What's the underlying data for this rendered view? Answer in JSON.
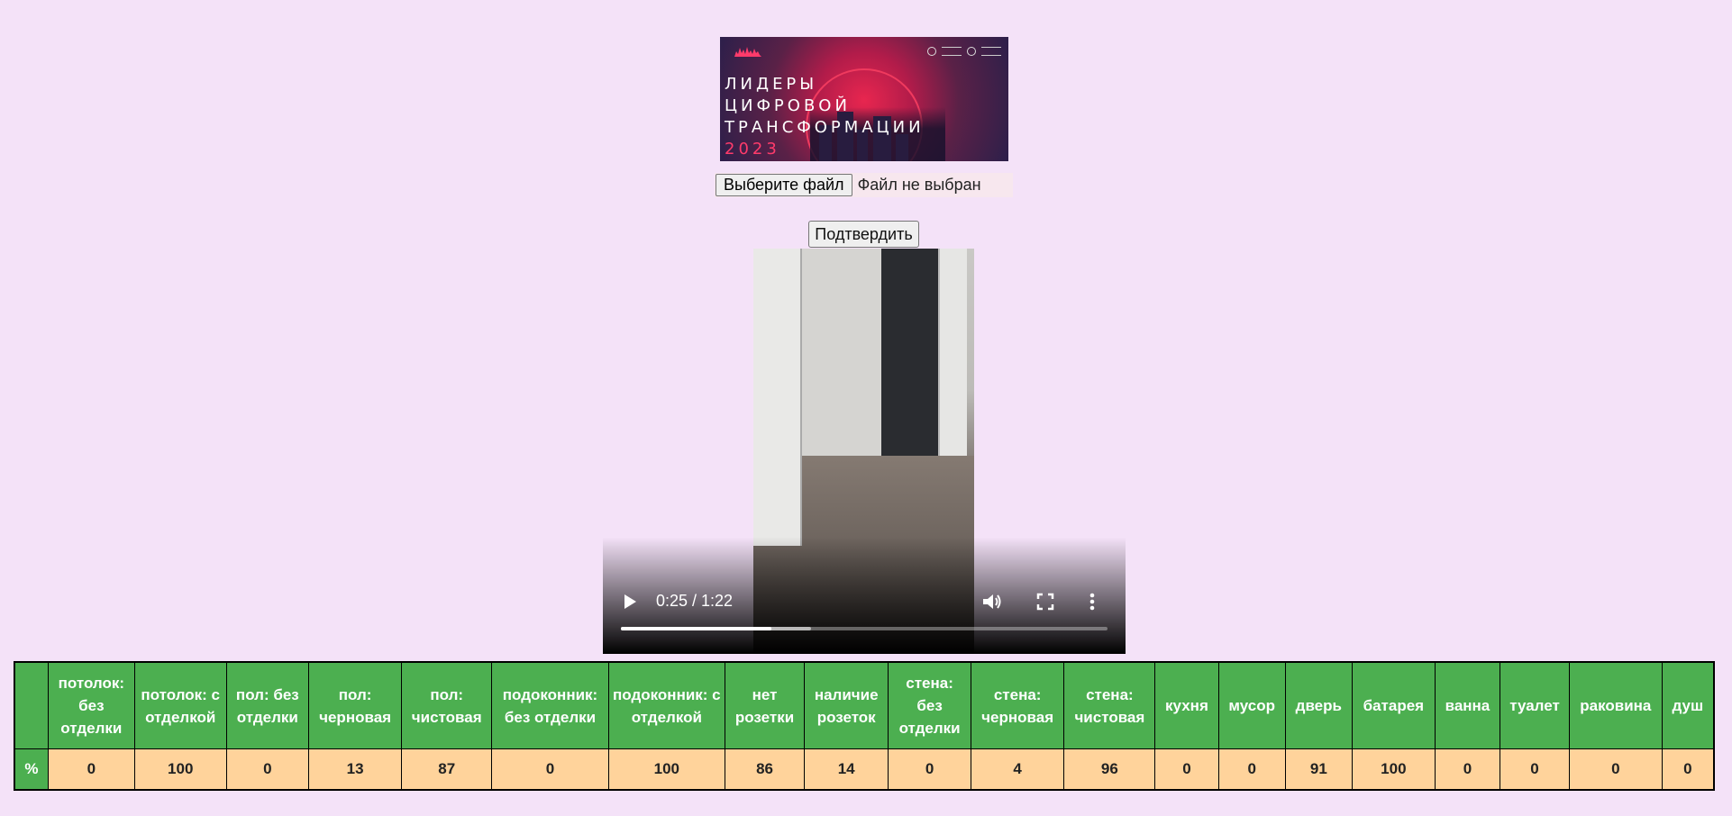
{
  "banner": {
    "line1": "ЛИДЕРЫ",
    "line2": "ЦИФРОВОЙ",
    "line3": "ТРАНСФОРМАЦИИ",
    "year": "2023"
  },
  "file_input": {
    "button_label": "Выберите файл",
    "status": "Файл не выбран"
  },
  "confirm_button": "Подтвердить",
  "video": {
    "time": "0:25 / 1:22",
    "played_fraction": 0.31,
    "buffered_fraction": 0.39
  },
  "table": {
    "headers": [
      "",
      "потолок: без отделки",
      "потолок: с отделкой",
      "пол: без отделки",
      "пол: черновая",
      "пол: чистовая",
      "подоконник: без отделки",
      "подоконник: с отделкой",
      "нет розетки",
      "наличие розеток",
      "стена: без отделки",
      "стена: черновая",
      "стена: чистовая",
      "кухня",
      "мусор",
      "дверь",
      "батарея",
      "ванна",
      "туалет",
      "раковина",
      "душ"
    ],
    "row_label": "%",
    "values": [
      "0",
      "100",
      "0",
      "13",
      "87",
      "0",
      "100",
      "86",
      "14",
      "0",
      "4",
      "96",
      "0",
      "0",
      "91",
      "100",
      "0",
      "0",
      "0",
      "0"
    ]
  }
}
